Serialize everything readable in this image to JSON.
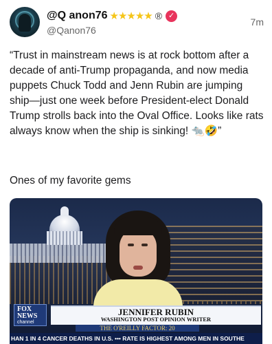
{
  "post": {
    "display_name": "@Q anon76",
    "stars": "★★★★★",
    "registered_mark": "®",
    "verified_badge_icon": "verified-badge-icon",
    "handle": "@Qanon76",
    "time": "7m",
    "body": "“Trust in mainstream news is at rock bottom after a decade of anti-Trump propaganda, and now media puppets Chuck Todd and Jenn Rubin are jumping ship—just one week before President-elect Donald Trump strolls back into the Oval Office. Looks like rats always know when the ship is sinking! 🐀🤣”",
    "caption": "Ones of my favorite gems"
  },
  "video": {
    "network_logo": "FOX NEWS",
    "network_sub": "channel",
    "guest_name": "JENNIFER RUBIN",
    "guest_title": "WASHINGTON POST OPINION WRITER",
    "show_name": "THE O'REILLY FACTOR: 20",
    "ticker": "HAN 1 IN 4 CANCER DEATHS IN U.S. ••• RATE IS HIGHEST AMONG MEN IN SOUTHE"
  },
  "colors": {
    "star": "#f5c518",
    "badge": "#e8345c",
    "fox_blue": "#1f3a78"
  }
}
